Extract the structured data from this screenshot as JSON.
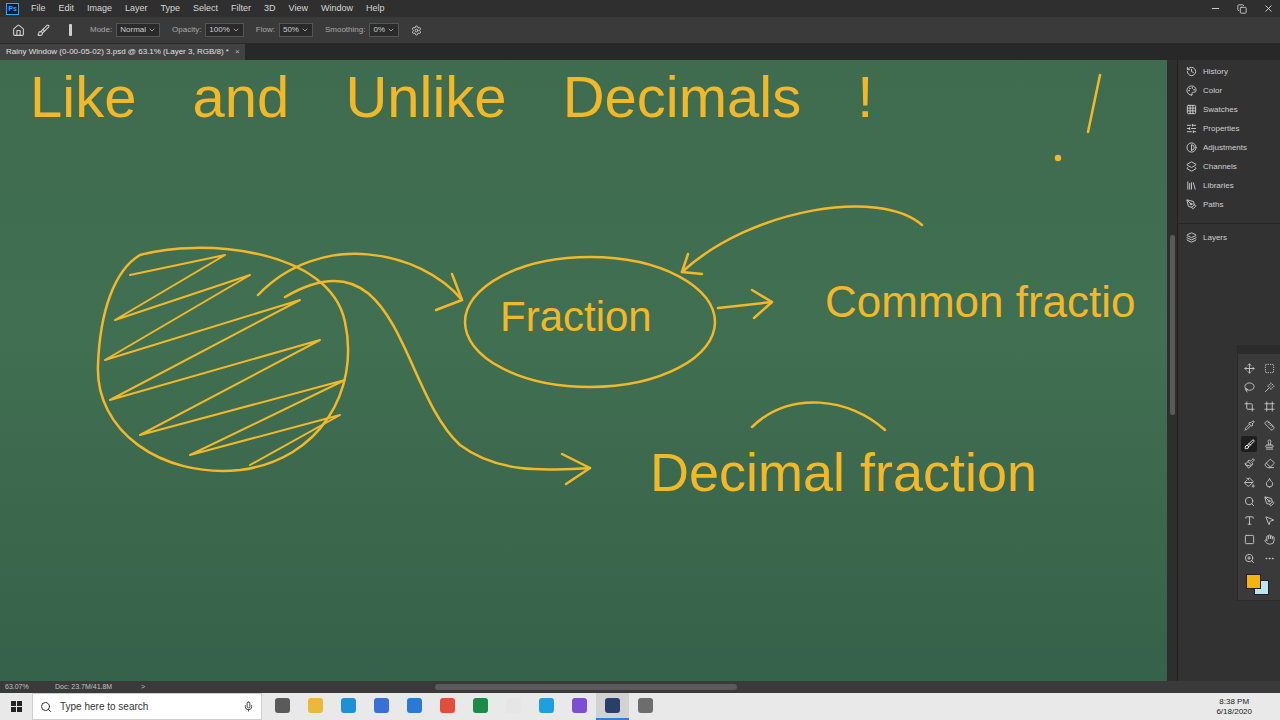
{
  "app": {
    "logo": "Ps"
  },
  "menu": [
    "File",
    "Edit",
    "Image",
    "Layer",
    "Type",
    "Select",
    "Filter",
    "3D",
    "View",
    "Window",
    "Help"
  ],
  "options_bar": {
    "mode_label": "Mode:",
    "mode": "Normal",
    "opacity_label": "Opacity:",
    "opacity": "100%",
    "flow_label": "Flow:",
    "flow": "50%",
    "smoothing_label": "Smoothing:",
    "smoothing": "0%"
  },
  "document_tab": {
    "title": "Rainy Window (0-00-05-02) 3.psd @ 63.1% (Layer 3, RGB/8) *",
    "close": "×"
  },
  "canvas": {
    "title": "Like and Unlike Decimals !",
    "fraction": "Fraction",
    "common": "Common fractio",
    "decimal": "Decimal fraction"
  },
  "panel_groups": [
    {
      "items": [
        "History",
        "Color",
        "Swatches",
        "Properties",
        "Adjustments",
        "Channels",
        "Libraries",
        "Paths"
      ]
    },
    {
      "items": [
        "Layers"
      ]
    }
  ],
  "tools": [
    {
      "selected": false
    },
    {
      "selected": false
    },
    {
      "selected": false
    },
    {
      "selected": false
    },
    {
      "selected": false
    },
    {
      "selected": false
    },
    {
      "selected": false
    },
    {
      "selected": false
    },
    {
      "selected": true
    },
    {
      "selected": false
    },
    {
      "selected": false
    },
    {
      "selected": false
    },
    {
      "selected": false
    },
    {
      "selected": false
    },
    {
      "selected": false
    },
    {
      "selected": false
    },
    {
      "selected": false
    },
    {
      "selected": false
    },
    {
      "selected": false
    },
    {
      "selected": false
    },
    {
      "selected": false
    },
    {
      "selected": false
    }
  ],
  "status_bar": {
    "zoom": "63.07%",
    "doc": "Doc: 23.7M/41.8M",
    "arrow": ">"
  },
  "taskbar": {
    "search_placeholder": "Type here to search",
    "time": "8:38 PM",
    "date": "6/18/2020",
    "apps": [
      {
        "color": "#5a5a5a",
        "selected": false
      },
      {
        "color": "#e8b93a",
        "selected": false
      },
      {
        "color": "#1f8fd6",
        "selected": false
      },
      {
        "color": "#3a6fd8",
        "selected": false
      },
      {
        "color": "#2a7ad5",
        "selected": false
      },
      {
        "color": "#e24d3c",
        "selected": false
      },
      {
        "color": "#1e8a4a",
        "selected": false
      },
      {
        "color": "#e6e6e6",
        "selected": false
      },
      {
        "color": "#1ea0e0",
        "selected": false
      },
      {
        "color": "#7b4fd0",
        "selected": false
      },
      {
        "color": "#2b3e6b",
        "selected": true
      },
      {
        "color": "#6d6d6d",
        "selected": false
      }
    ]
  }
}
